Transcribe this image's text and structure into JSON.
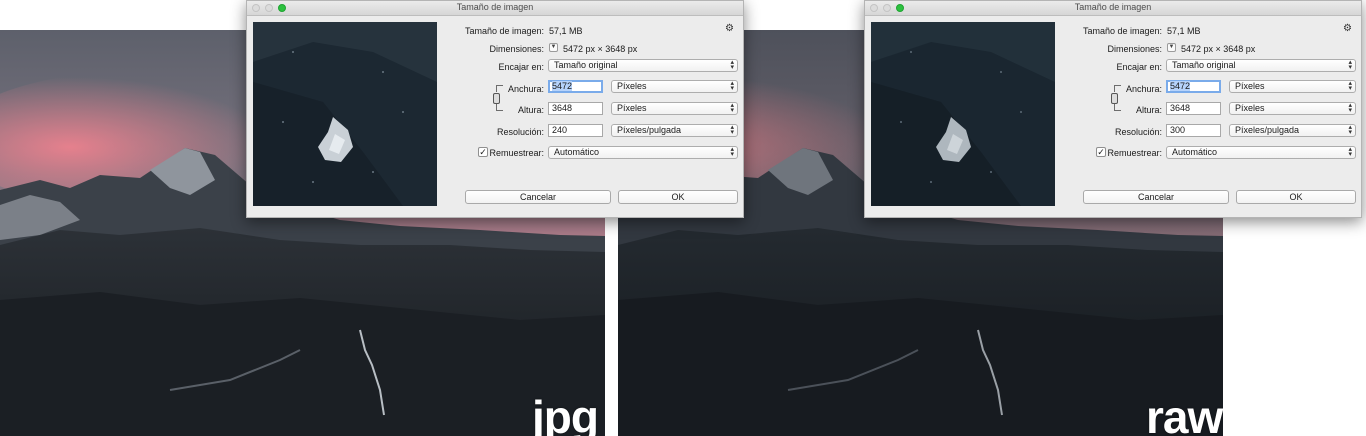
{
  "photos": [
    {
      "label": "jpg",
      "tone": "jpg"
    },
    {
      "label": "raw",
      "tone": "raw"
    }
  ],
  "dialogs": [
    {
      "title": "Tamaño de imagen",
      "image_size_label": "Tamaño de imagen:",
      "image_size_value": "57,1 MB",
      "dimensions_label": "Dimensiones:",
      "dimensions_value": "5472 px × 3648 px",
      "fit_label": "Encajar en:",
      "fit_value": "Tamaño original",
      "width_label": "Anchura:",
      "width_value": "5472",
      "width_unit": "Píxeles",
      "height_label": "Altura:",
      "height_value": "3648",
      "height_unit": "Píxeles",
      "resolution_label": "Resolución:",
      "resolution_value": "240",
      "resolution_unit": "Píxeles/pulgada",
      "resample_label": "Remuestrear:",
      "resample_checked": true,
      "resample_value": "Automático",
      "cancel_label": "Cancelar",
      "ok_label": "OK"
    },
    {
      "title": "Tamaño de imagen",
      "image_size_label": "Tamaño de imagen:",
      "image_size_value": "57,1 MB",
      "dimensions_label": "Dimensiones:",
      "dimensions_value": "5472 px × 3648 px",
      "fit_label": "Encajar en:",
      "fit_value": "Tamaño original",
      "width_label": "Anchura:",
      "width_value": "5472",
      "width_unit": "Píxeles",
      "height_label": "Altura:",
      "height_value": "3648",
      "height_unit": "Píxeles",
      "resolution_label": "Resolución:",
      "resolution_value": "300",
      "resolution_unit": "Píxeles/pulgada",
      "resample_label": "Remuestrear:",
      "resample_checked": true,
      "resample_value": "Automático",
      "cancel_label": "Cancelar",
      "ok_label": "OK"
    }
  ],
  "icons": {
    "gear": "gear-icon",
    "checkmark": "checkmark-icon",
    "disclosure": "disclosure-triangle-icon",
    "chain": "chain-link-icon",
    "popup_arrows": "up-down-arrows-icon"
  },
  "colors": {
    "sky_pink": "#e9788a",
    "forest_dark": "#1d2228",
    "zoom_green": "#2cc13f",
    "focus_ring": "#7aabea"
  }
}
